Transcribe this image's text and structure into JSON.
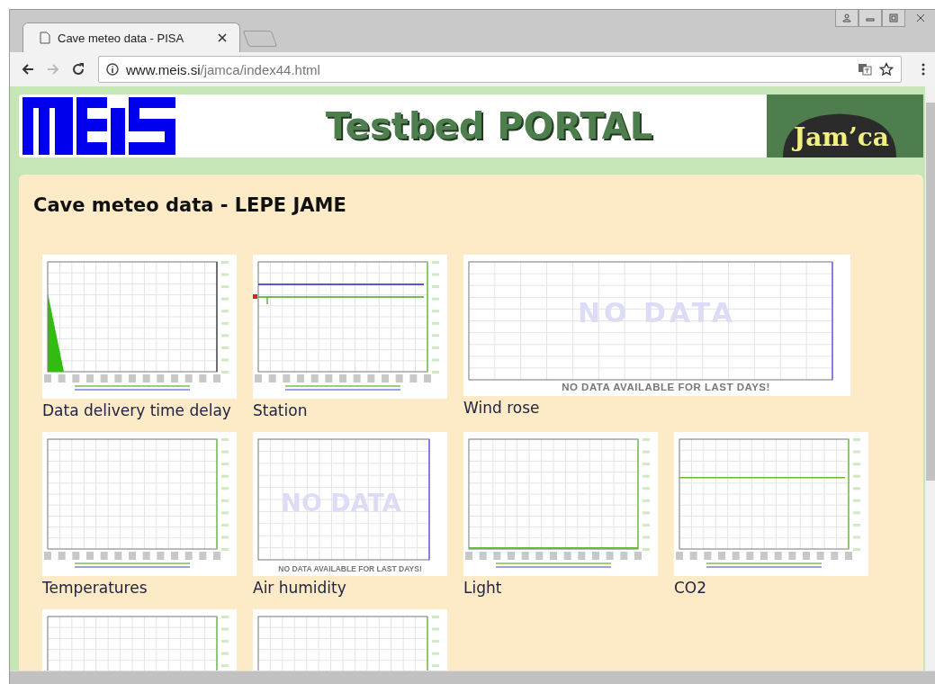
{
  "browser": {
    "tab": {
      "title": "Cave meteo data - PISA",
      "selected": true
    },
    "url": {
      "host": "www.meis.si",
      "path": "/jamca/index44.html"
    }
  },
  "header": {
    "title": "Testbed PORTAL",
    "badge": "Jam’ca"
  },
  "page": {
    "heading": "Cave meteo data - LEPE JAME"
  },
  "charts": [
    {
      "kind": "area",
      "label": "Data delivery time delay"
    },
    {
      "kind": "lines",
      "label": "Station"
    },
    {
      "kind": "nodata",
      "wide": true,
      "label": "Wind rose",
      "overlay": "NO DATA",
      "notice": "NO DATA AVAILABLE FOR LAST DAYS!"
    },
    {
      "kind": "empty",
      "label": "Temperatures"
    },
    {
      "kind": "nodata",
      "label": "Air humidity",
      "overlay": "NO DATA",
      "notice": "NO DATA AVAILABLE FOR LAST DAYS!"
    },
    {
      "kind": "baseline",
      "label": "Light"
    },
    {
      "kind": "flat",
      "label": "CO2"
    },
    {
      "kind": "empty"
    },
    {
      "kind": "empty"
    }
  ]
}
